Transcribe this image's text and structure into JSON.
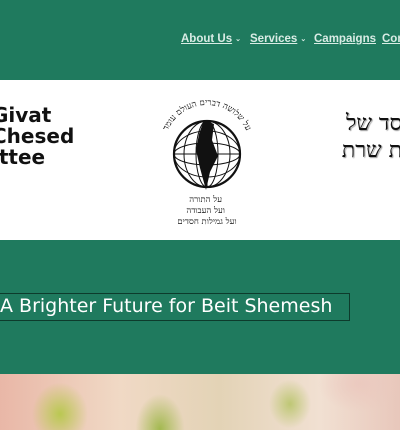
{
  "nav": {
    "items": [
      {
        "label": "About Us",
        "has_dropdown": true
      },
      {
        "label": "Services",
        "has_dropdown": true
      },
      {
        "label": "Campaigns",
        "has_dropdown": false
      },
      {
        "label": "Cont",
        "has_dropdown": false
      }
    ],
    "chevron": "⌄"
  },
  "banner": {
    "english_lines": [
      "Givat",
      "Chesed",
      "ittee"
    ],
    "hebrew_lines": [
      "סד של",
      "ת שרת"
    ],
    "logo": {
      "top_arc_text": "על שלושה דברים העולם עומד",
      "bottom_lines": [
        "על התורה",
        "ועל העבודה",
        "ועל גמילות חסדים"
      ]
    }
  },
  "hero": {
    "slogan": "A Brighter Future for Beit Shemesh"
  },
  "colors": {
    "brand_green": "#1f7a5e",
    "nav_text": "#d9ece5"
  }
}
